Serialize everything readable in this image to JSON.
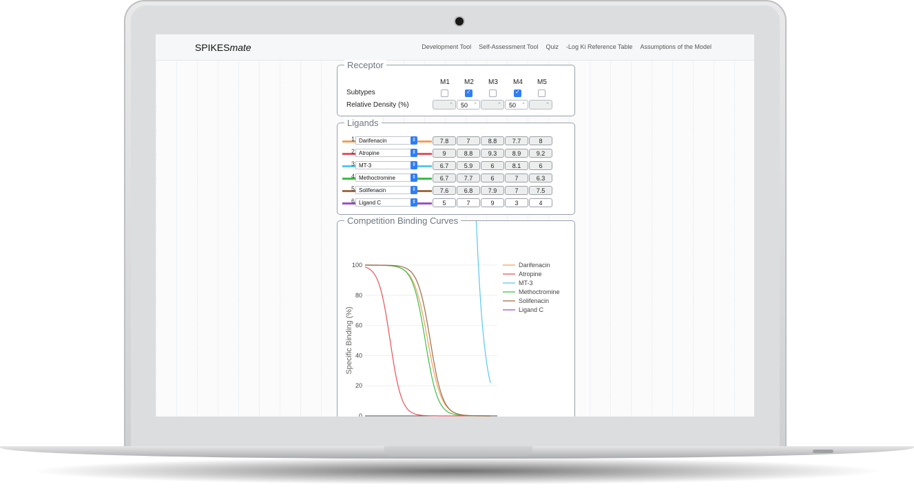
{
  "navbar": {
    "brand_main": "SPIKES",
    "brand_italic": "mate",
    "links": [
      "Development Tool",
      "Self-Assessment Tool",
      "Quiz",
      "-Log Ki Reference Table",
      "Assumptions of the Model"
    ]
  },
  "receptor": {
    "title": "Receptor",
    "subtypes_label": "Subtypes",
    "density_label": "Relative Density (%)",
    "columns": [
      "M1",
      "M2",
      "M3",
      "M4",
      "M5"
    ],
    "checked": [
      false,
      true,
      false,
      true,
      false
    ],
    "densities": [
      "",
      "50",
      "",
      "50",
      ""
    ]
  },
  "ligands": {
    "title": "Ligands",
    "rows": [
      {
        "num": "1.",
        "name": "Darifenacin",
        "color": "#f0a05a",
        "values": [
          "7.8",
          "7",
          "8.8",
          "7.7",
          "8"
        ]
      },
      {
        "num": "2.",
        "name": "Atropine",
        "color": "#e8505b",
        "values": [
          "9",
          "8.8",
          "9.3",
          "8.9",
          "9.2"
        ]
      },
      {
        "num": "3.",
        "name": "MT-3",
        "color": "#55c8ee",
        "values": [
          "6.7",
          "5.9",
          "6",
          "8.1",
          "6"
        ]
      },
      {
        "num": "4.",
        "name": "Methoctromine",
        "color": "#3cbd45",
        "values": [
          "6.7",
          "7.7",
          "6",
          "7",
          "6.3"
        ]
      },
      {
        "num": "5.",
        "name": "Solifenacin",
        "color": "#9c6b45",
        "values": [
          "7.6",
          "6.8",
          "7.9",
          "7",
          "7.5"
        ]
      },
      {
        "num": "6.",
        "name": "Ligand C",
        "color": "#9b4fc8",
        "values": [
          "5",
          "7",
          "9",
          "3",
          "4"
        ]
      }
    ]
  },
  "chart_data": {
    "type": "line",
    "title": "Competition Binding Curves",
    "ylabel": "Specific Binding (%)",
    "ylim": [
      0,
      100
    ],
    "yticks": [
      "100",
      "80",
      "60",
      "40",
      "20",
      "0"
    ],
    "legend_position": "right",
    "series": [
      {
        "name": "Darifenacin",
        "color": "#f0a05a"
      },
      {
        "name": "Atropine",
        "color": "#e8505b"
      },
      {
        "name": "MT-3",
        "color": "#55c8ee"
      },
      {
        "name": "Methoctromine",
        "color": "#3cbd45"
      },
      {
        "name": "Solifenacin",
        "color": "#9c6b45"
      },
      {
        "name": "Ligand C",
        "color": "#9b4fc8"
      }
    ]
  }
}
